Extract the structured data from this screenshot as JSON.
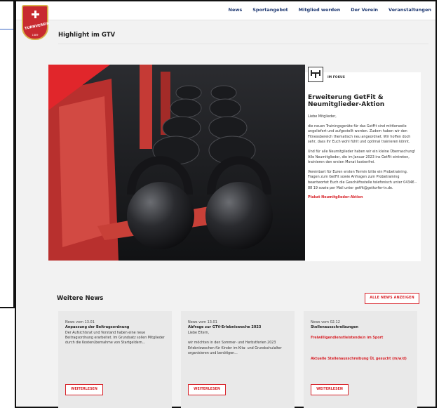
{
  "nav": [
    "News",
    "Sportangebot",
    "Mitglied werden",
    "Der Verein",
    "Veranstaltungen"
  ],
  "logo": {
    "text": "TURNVEREIN",
    "year": "1889"
  },
  "highlight": {
    "section_title": "Highlight im GTV",
    "focus_label": "IM FOKUS",
    "title": "Erweiterung GetFit & Neumitglieder-Aktion",
    "paragraphs": [
      "Liebe Mitglieder,",
      "die neuen Trainingsgeräte für das GetFit sind mittlerweile angeliefert und aufgestellt worden. Zudem haben wir den Fitnessbereich thematisch neu angeordnet. Wir hoffen doch sehr, dass Ihr Euch wohl fühlt und optimal trainieren könnt.",
      "Und für alle Neumitglieder haben wir ein kleine Überraschung! Alle Neumitglieder, die im Januar 2023 ins GetFit eintreten, trainieren den ersten Monat kostenfrei.",
      "Vereinbart für Euren ersten Termin bitte ein Probetraining. Fragen zum GetFit sowie Anfragen zum Probetraining beantwortet Euch die Geschäftsstelle telefonisch unter 04346 - 88 19 sowie per Mail unter getfit@gettorfer-tv.de."
    ],
    "link": "Plakat Neumitglieder-Aktion"
  },
  "news": {
    "heading": "Weitere News",
    "all_label": "ALLE NEWS ANZEIGEN",
    "items": [
      {
        "date": "News vom 13.01",
        "title": "Anpassung der Beitragsordnung",
        "excerpt": "Der Aufsichtsrat und Vorstand haben eine neue Beitragsordnung erarbeitet. Im Grundsatz sollen Mitglieder durch die Kostenübernahme von Startgeldern...",
        "red1": "",
        "red2": "",
        "button": "WEITERLESEN"
      },
      {
        "date": "News vom 13.01",
        "title": "Abfrage zur GTV-Erlebniswoche 2023",
        "excerpt": "Liebe Eltern,\n\nwir möchten in den Sommer- und Herbstferien 2023 Erlebniswochen für Kinder im Kita- und Grundschulalter organisieren und benötigen...",
        "red1": "",
        "red2": "",
        "button": "WEITERLESEN"
      },
      {
        "date": "News vom 02.12",
        "title": "Stellenausschreibungen",
        "excerpt": "",
        "red1": "Freiwilligendienstleistende/n im Sport",
        "red2": "Aktuelle Stellenausschreibung ÜL gesucht (m/w/d)",
        "button": "WEITERLESEN"
      }
    ]
  },
  "colors": {
    "accent": "#d8242b",
    "nav": "#203a73",
    "background": "#f2f2f2"
  }
}
